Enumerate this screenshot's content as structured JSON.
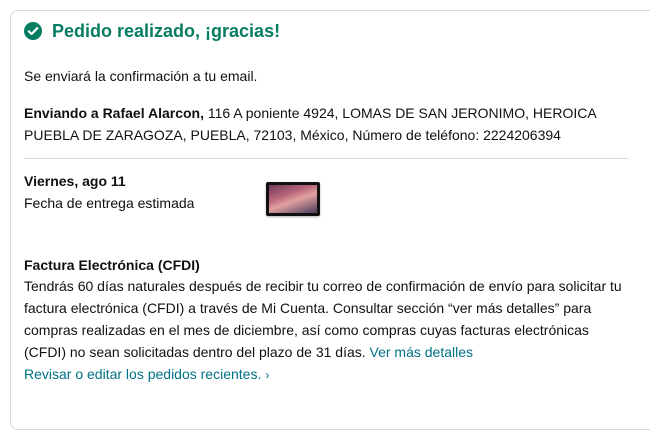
{
  "header": {
    "title": "Pedido realizado, ¡gracias!",
    "accent_color": "#067d62",
    "icon": "check-circle-icon"
  },
  "email_message": "Se enviará la confirmación a tu email.",
  "address": {
    "prefix": "Enviando a Rafael Alarcon,",
    "full": " 116 A poniente 4924, LOMAS DE SAN JERONIMO, HEROICA PUEBLA DE ZARAGOZA, PUEBLA, 72103, México, Número de teléfono: 2224206394"
  },
  "delivery": {
    "date": "Viernes, ago 11",
    "label": "Fecha de entrega estimada"
  },
  "factura": {
    "title": "Factura Electrónica (CFDI)",
    "text": "Tendrás 60 días naturales después de recibir tu correo de confirmación de envío para solicitar tu factura electrónica (CFDI) a través de Mi Cuenta. Consultar sección “ver más detalles” para compras realizadas en el mes de diciembre, así como compras cuyas facturas electrónicas (CFDI) no sean solicitadas dentro del plazo de 31 días. ",
    "link": "Ver más detalles"
  },
  "review_link": {
    "label": "Revisar o editar los pedidos recientes.",
    "icon": "chevron-right-icon"
  },
  "colors": {
    "link": "#007185",
    "border": "#d5d9d9"
  }
}
